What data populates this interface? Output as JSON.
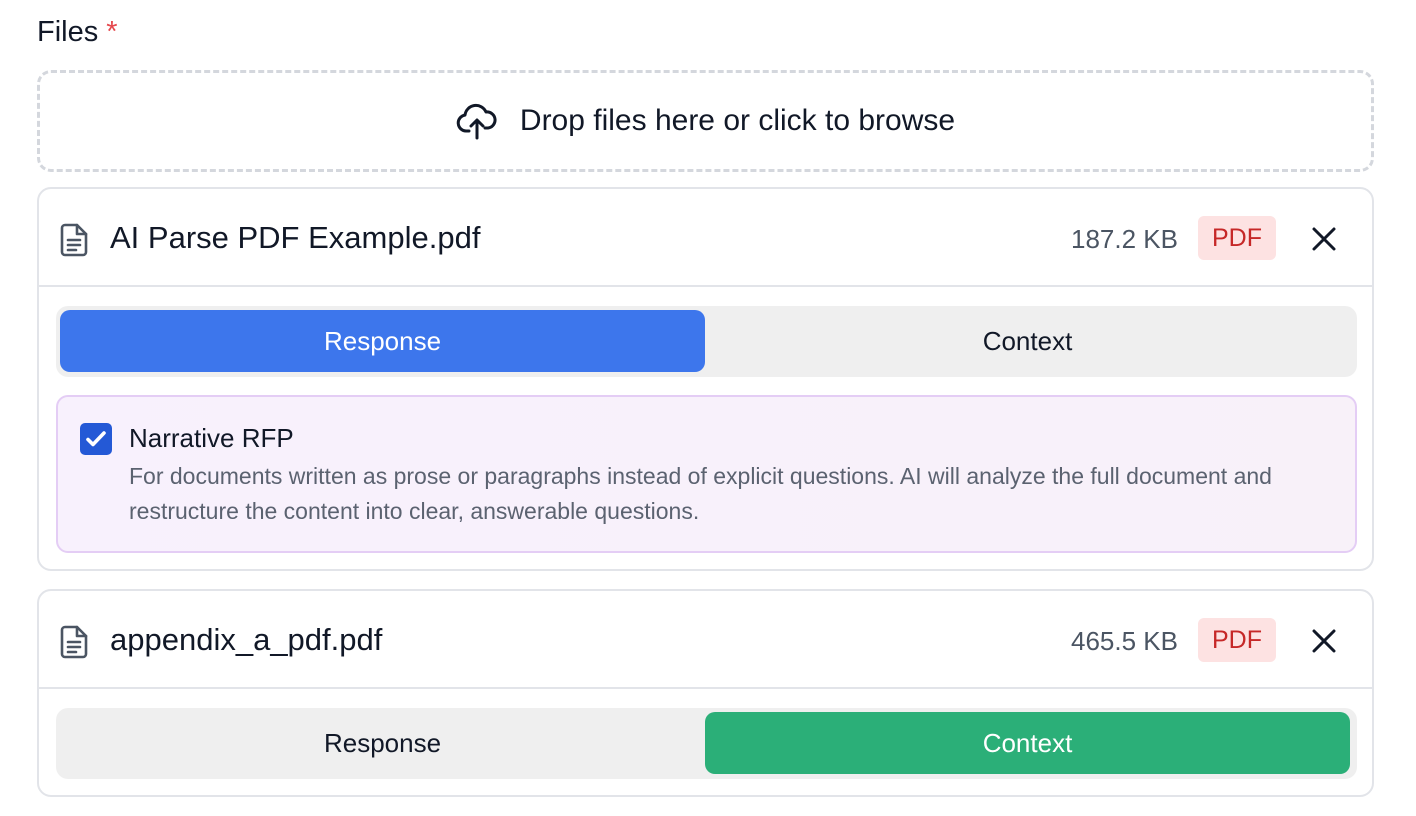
{
  "field": {
    "label": "Files",
    "required_mark": "*"
  },
  "dropzone": {
    "text": "Drop files here or click to browse",
    "icon": "cloud-upload-icon"
  },
  "files": [
    {
      "name": "AI Parse PDF Example.pdf",
      "size": "187.2 KB",
      "type_badge": "PDF",
      "icon": "document-icon",
      "tabs": {
        "response": "Response",
        "context": "Context",
        "selected": "Response"
      },
      "option": {
        "checked": true,
        "title": "Narrative RFP",
        "description": "For documents written as prose or paragraphs instead of explicit questions. AI will analyze the full document and restructure the content into clear, answerable questions."
      }
    },
    {
      "name": "appendix_a_pdf.pdf",
      "size": "465.5 KB",
      "type_badge": "PDF",
      "icon": "document-icon",
      "tabs": {
        "response": "Response",
        "context": "Context",
        "selected": "Context"
      }
    }
  ],
  "colors": {
    "response_active": "#3d76ec",
    "context_active": "#2baf78",
    "pdf_badge_bg": "#fde2e2",
    "pdf_badge_text": "#c62828",
    "required": "#e5484d",
    "checkbox": "#2459d6"
  }
}
